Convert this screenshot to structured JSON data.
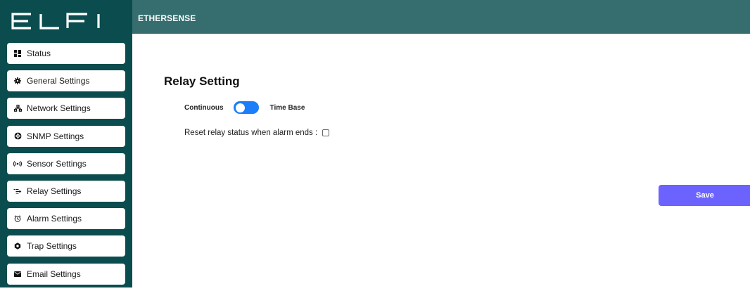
{
  "brand": {
    "logo_text": "ELFI",
    "logo_color": "#ffffff"
  },
  "header": {
    "title": "ETHERSENSE",
    "background": "#366d6e"
  },
  "sidebar": {
    "background": "#0b4d4e",
    "items": [
      {
        "label": "Status",
        "icon": "grid-icon"
      },
      {
        "label": "General Settings",
        "icon": "gear-icon"
      },
      {
        "label": "Network Settings",
        "icon": "network-icon"
      },
      {
        "label": "SNMP Settings",
        "icon": "snmp-icon"
      },
      {
        "label": "Sensor Settings",
        "icon": "signal-icon"
      },
      {
        "label": "Relay Settings",
        "icon": "relay-icon"
      },
      {
        "label": "Alarm Settings",
        "icon": "alarm-clock-icon"
      },
      {
        "label": "Trap Settings",
        "icon": "trap-hexagon-icon"
      },
      {
        "label": "Email Settings",
        "icon": "envelope-icon"
      }
    ]
  },
  "main": {
    "title": "Relay Setting",
    "mode": {
      "left_label": "Continuous",
      "right_label": "Time Base",
      "toggle_on": true,
      "toggle_color": "#1c7ef8"
    },
    "reset": {
      "label": "Reset relay status when alarm ends :",
      "checked": false
    },
    "save_label": "Save",
    "save_color": "#6c63ff"
  }
}
